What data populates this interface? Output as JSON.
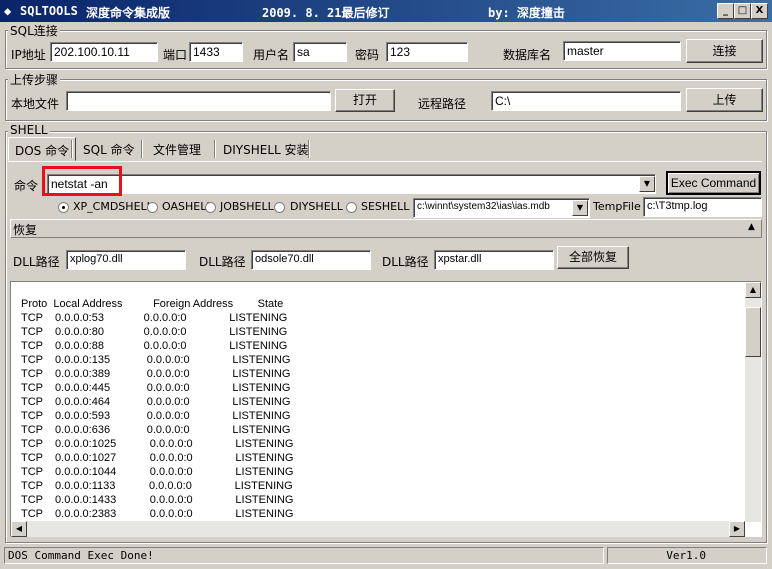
{
  "title": {
    "app": "SQLTOOLS",
    "edition": "深度命令集成版",
    "date": "2009. 8. 21最后修订",
    "author": "by: 深度撞击",
    "minimize": "_",
    "restore": "□",
    "close": "X"
  },
  "sql": {
    "group_title": "SQL连接",
    "ip_label": "IP地址",
    "ip_value": "202.100.10.11",
    "port_label": "端口",
    "port_value": "1433",
    "user_label": "用户名",
    "user_value": "sa",
    "pass_label": "密码",
    "pass_value": "123",
    "db_label": "数据库名",
    "db_value": "master",
    "connect_button": "连接"
  },
  "upload": {
    "group_title": "上传步骤",
    "local_label": "本地文件",
    "local_value": "",
    "open_button": "打开",
    "remote_label": "远程路径",
    "remote_value": "C:\\",
    "upload_button": "上传"
  },
  "shell": {
    "group_title": "SHELL",
    "tabs": [
      "DOS 命令",
      "SQL 命令",
      "文件管理",
      "DIYSHELL 安装"
    ],
    "command_label": "命令",
    "command_value": "netstat -an",
    "exec_button": "Exec Command",
    "radios": [
      "XP_CMDSHELL",
      "OASHELL",
      "JOBSHELL",
      "DIYSHELL",
      "SESHELL"
    ],
    "mdb_path": "c:\\winnt\\system32\\ias\\ias.mdb",
    "tempfile_label": "TempFile",
    "tempfile_value": "c:\\T3tmp.log"
  },
  "restore": {
    "title": "恢复",
    "dll_label_1": "DLL路径",
    "dll_value_1": "xplog70.dll",
    "dll_label_2": "DLL路径",
    "dll_value_2": "odsole70.dll",
    "dll_label_3": "DLL路径",
    "dll_value_3": "xpstar.dll",
    "restore_all_button": "全部恢复"
  },
  "output": {
    "header": "Proto  Local Address          Foreign Address        State",
    "lines": [
      "TCP    0.0.0.0:53             0.0.0.0:0              LISTENING",
      "TCP    0.0.0.0:80             0.0.0.0:0              LISTENING",
      "TCP    0.0.0.0:88             0.0.0.0:0              LISTENING",
      "TCP    0.0.0.0:135            0.0.0.0:0              LISTENING",
      "TCP    0.0.0.0:389            0.0.0.0:0              LISTENING",
      "TCP    0.0.0.0:445            0.0.0.0:0              LISTENING",
      "TCP    0.0.0.0:464            0.0.0.0:0              LISTENING",
      "TCP    0.0.0.0:593            0.0.0.0:0              LISTENING",
      "TCP    0.0.0.0:636            0.0.0.0:0              LISTENING",
      "TCP    0.0.0.0:1025           0.0.0.0:0              LISTENING",
      "TCP    0.0.0.0:1027           0.0.0.0:0              LISTENING",
      "TCP    0.0.0.0:1044           0.0.0.0:0              LISTENING",
      "TCP    0.0.0.0:1133           0.0.0.0:0              LISTENING",
      "TCP    0.0.0.0:1433           0.0.0.0:0              LISTENING",
      "TCP    0.0.0.0:2383           0.0.0.0:0              LISTENING"
    ]
  },
  "status": {
    "message": "DOS Command Exec Done!",
    "version": "Ver1.0"
  }
}
